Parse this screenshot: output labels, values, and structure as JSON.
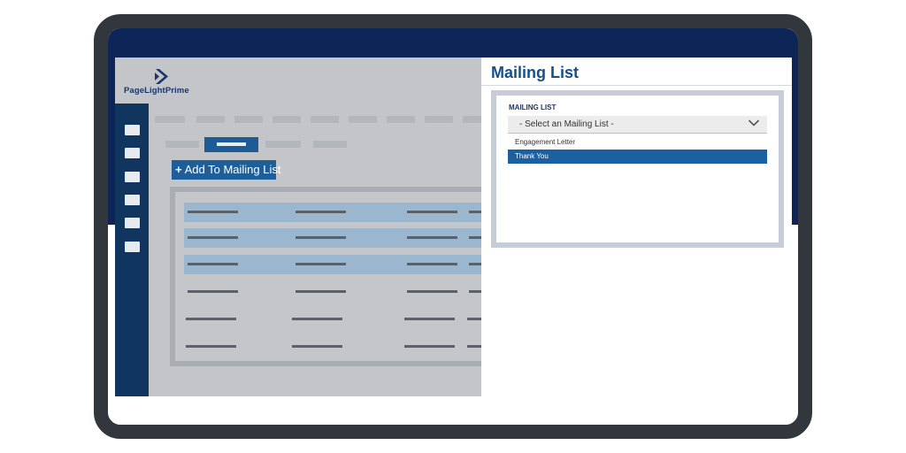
{
  "app": {
    "logo_text": "PageLightPrime",
    "add_button": {
      "plus": "+",
      "label": "Add To Mailing List"
    }
  },
  "panel": {
    "title": "Mailing List",
    "field_label": "MAILING LIST",
    "select": {
      "selected_text": "- Select an Mailing List -",
      "options": [
        "Engagement Letter",
        "Thank You"
      ],
      "highlighted_option": "Thank You"
    }
  },
  "colors": {
    "frame": "#32373d",
    "band": "#0d2557",
    "sidebar": "#10365f",
    "accent": "#1b60a0",
    "row_highlight": "#9bb7d0"
  },
  "icons": [
    "logo-chevron-icon",
    "chevron-down-icon"
  ]
}
